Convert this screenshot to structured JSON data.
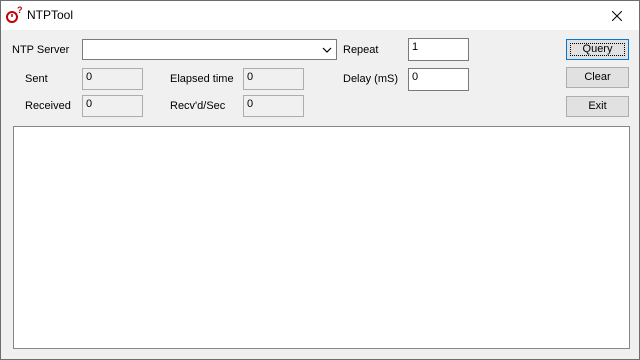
{
  "window": {
    "title": "NTPTool",
    "close_glyph": "✕"
  },
  "form": {
    "ntp_server": {
      "label": "NTP Server",
      "value": ""
    },
    "repeat": {
      "label": "Repeat",
      "value": "1"
    },
    "delay": {
      "label": "Delay (mS)",
      "value": "0"
    },
    "sent": {
      "label": "Sent",
      "value": "0"
    },
    "received": {
      "label": "Received",
      "value": "0"
    },
    "elapsed": {
      "label": "Elapsed time",
      "value": "0"
    },
    "recvd_per_sec": {
      "label": "Recv'd/Sec",
      "value": "0"
    }
  },
  "buttons": {
    "query": "Query",
    "clear": "Clear",
    "exit": "Exit"
  },
  "output": {
    "text": ""
  },
  "colors": {
    "focus_border": "#0078d7",
    "icon_red": "#c00000"
  }
}
